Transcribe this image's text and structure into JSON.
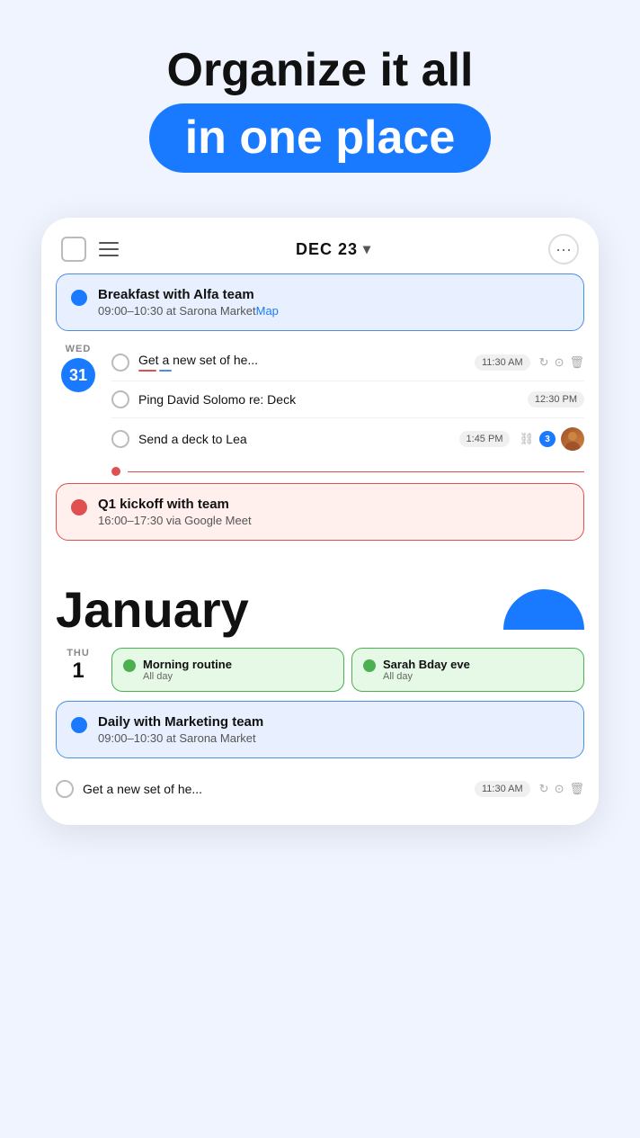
{
  "hero": {
    "line1": "Organize it all",
    "line2": "in one place"
  },
  "header": {
    "date": "DEC 23",
    "more_icon": "···"
  },
  "dec_events": {
    "breakfast": {
      "title": "Breakfast with Alfa team",
      "time": "09:00–10:30 at Sarona Market",
      "map_label": "Map"
    },
    "tasks": [
      {
        "text": "Get a new set of he...",
        "time": "11:30 AM",
        "has_underlines": true
      },
      {
        "text": "Ping David Solomo re: Deck",
        "time": "12:30 PM",
        "has_underlines": false
      },
      {
        "text": "Send a deck to Lea",
        "time": "1:45 PM",
        "has_avatar": true,
        "badge": "3"
      }
    ],
    "kickoff": {
      "title": "Q1 kickoff with team",
      "time": "16:00–17:30 via Google Meet"
    }
  },
  "january": {
    "title": "January",
    "day_name": "THU",
    "day_num": "1",
    "allday": [
      {
        "title": "Morning routine",
        "sub": "All day"
      },
      {
        "title": "Sarah Bday eve",
        "sub": "All day"
      }
    ],
    "daily_event": {
      "title": "Daily with Marketing team",
      "time": "09:00–10:30 at Sarona Market"
    },
    "task": {
      "text": "Get a new set of he...",
      "time": "11:30 AM"
    }
  }
}
